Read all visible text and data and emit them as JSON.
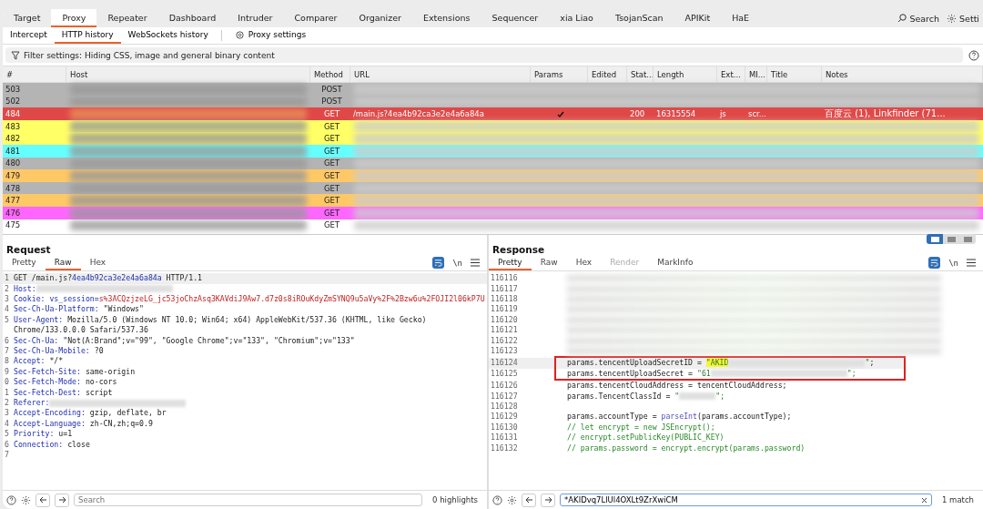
{
  "tabs": [
    {
      "label": "Target",
      "selected": false
    },
    {
      "label": "Proxy",
      "selected": true
    },
    {
      "label": "Repeater",
      "selected": false
    },
    {
      "label": "Dashboard",
      "selected": false
    },
    {
      "label": "Intruder",
      "selected": false
    },
    {
      "label": "Comparer",
      "selected": false
    },
    {
      "label": "Organizer",
      "selected": false
    },
    {
      "label": "Extensions",
      "selected": false
    },
    {
      "label": "Sequencer",
      "selected": false
    },
    {
      "label": "xia Liao",
      "selected": false
    },
    {
      "label": "TsojanScan",
      "selected": false
    },
    {
      "label": "APIKit",
      "selected": false
    },
    {
      "label": "HaE",
      "selected": false
    }
  ],
  "top_actions": {
    "search": "Search",
    "settings": "Setti"
  },
  "sub_tabs": [
    {
      "label": "Intercept",
      "selected": false
    },
    {
      "label": "HTTP history",
      "selected": true
    },
    {
      "label": "WebSockets history",
      "selected": false
    }
  ],
  "proxy_settings": "Proxy settings",
  "filter": "Filter settings: Hiding CSS, image and general binary content",
  "table": {
    "columns": [
      "#",
      "Host",
      "Method",
      "URL",
      "Params",
      "Edited",
      "Stat...",
      "Length",
      "Ext...",
      "MI...",
      "Title",
      "Notes"
    ],
    "rows": [
      {
        "number": "503",
        "method": "POST",
        "color": "#b4b4b4",
        "selected": false
      },
      {
        "number": "502",
        "method": "POST",
        "color": "#b4b4b4",
        "selected": false
      },
      {
        "number": "484",
        "method": "GET",
        "color": "#e04848",
        "selected": true,
        "url": "/main.js?4ea4b92ca3e2e4a6a84a",
        "params": true,
        "status": "200",
        "length": "16315554",
        "ext": "js",
        "mime": "scr...",
        "notes": "百度云 (1), Linkfinder (71..."
      },
      {
        "number": "483",
        "method": "GET",
        "color": "#ffff66",
        "selected": false
      },
      {
        "number": "482",
        "method": "GET",
        "color": "#ffff66",
        "selected": false
      },
      {
        "number": "481",
        "method": "GET",
        "color": "#66ffff",
        "selected": false
      },
      {
        "number": "480",
        "method": "GET",
        "color": "#b4b4b4",
        "selected": false
      },
      {
        "number": "479",
        "method": "GET",
        "color": "#ffc866",
        "selected": false
      },
      {
        "number": "478",
        "method": "GET",
        "color": "#b4b4b4",
        "selected": false
      },
      {
        "number": "477",
        "method": "GET",
        "color": "#ffc866",
        "selected": false
      },
      {
        "number": "476",
        "method": "GET",
        "color": "#ff66ff",
        "selected": false
      },
      {
        "number": "475",
        "method": "GET",
        "color": "#ffffff",
        "selected": false
      }
    ]
  },
  "request": {
    "title": "Request",
    "tabs": [
      {
        "label": "Pretty",
        "selected": false
      },
      {
        "label": "Raw",
        "selected": true
      },
      {
        "label": "Hex",
        "selected": false
      }
    ],
    "wrap_icon": "\\n",
    "lines": [
      {
        "num": "1",
        "segments": [
          {
            "text": "GET /main.js?",
            "kind": "plain"
          },
          {
            "text": "4ea4b92ca3e2e4a6a84a",
            "kind": "name"
          },
          {
            "text": " HTTP/1.1",
            "kind": "plain"
          }
        ],
        "current": true
      },
      {
        "num": "2",
        "segments": [
          {
            "text": "Host:",
            "kind": "name"
          },
          {
            "kind": "redacted"
          }
        ],
        "current": false
      },
      {
        "num": "3",
        "segments": [
          {
            "text": "Cookie:",
            "kind": "name"
          },
          {
            "text": " vs_session=",
            "kind": "name"
          },
          {
            "text": "s%3ACQzjzeLG_jc53joChzAsq3KAVdiJ9Aw7.d7z0s8iROuKdyZmSYNQ9u5aVy%2F%2Bzw6u%2FOJI2l06kP7U",
            "kind": "cookie"
          }
        ],
        "current": false
      },
      {
        "num": "4",
        "segments": [
          {
            "text": "Sec-Ch-Ua-Platform:",
            "kind": "name"
          },
          {
            "text": " \"Windows\"",
            "kind": "plain"
          }
        ],
        "current": false
      },
      {
        "num": "5",
        "segments": [
          {
            "text": "User-Agent:",
            "kind": "name"
          },
          {
            "text": " Mozilla/5.0 (Windows NT 10.0; Win64; x64) AppleWebKit/537.36 (KHTML, like Gecko) Chrome/133.0.0.0 Safari/537.36",
            "kind": "plain"
          }
        ],
        "current": false
      },
      {
        "num": "6",
        "segments": [
          {
            "text": "Sec-Ch-Ua:",
            "kind": "name"
          },
          {
            "text": " \"Not(A:Brand\";v=\"99\", \"Google Chrome\";v=\"133\", \"Chromium\";v=\"133\"",
            "kind": "plain"
          }
        ],
        "current": false
      },
      {
        "num": "7",
        "segments": [
          {
            "text": "Sec-Ch-Ua-Mobile:",
            "kind": "name"
          },
          {
            "text": " ?0",
            "kind": "plain"
          }
        ],
        "current": false
      },
      {
        "num": "8",
        "segments": [
          {
            "text": "Accept:",
            "kind": "name"
          },
          {
            "text": " */*",
            "kind": "plain"
          }
        ],
        "current": false
      },
      {
        "num": "9",
        "segments": [
          {
            "text": "Sec-Fetch-Site:",
            "kind": "name"
          },
          {
            "text": " same-origin",
            "kind": "plain"
          }
        ],
        "current": false
      },
      {
        "num": "0",
        "segments": [
          {
            "text": "Sec-Fetch-Mode:",
            "kind": "name"
          },
          {
            "text": " no-cors",
            "kind": "plain"
          }
        ],
        "current": false
      },
      {
        "num": "1",
        "segments": [
          {
            "text": "Sec-Fetch-Dest:",
            "kind": "name"
          },
          {
            "text": " script",
            "kind": "plain"
          }
        ],
        "current": false
      },
      {
        "num": "2",
        "segments": [
          {
            "text": "Referer:",
            "kind": "name"
          },
          {
            "kind": "redacted"
          }
        ],
        "current": false
      },
      {
        "num": "3",
        "segments": [
          {
            "text": "Accept-Encoding:",
            "kind": "name"
          },
          {
            "text": " gzip, deflate, br",
            "kind": "plain"
          }
        ],
        "current": false
      },
      {
        "num": "4",
        "segments": [
          {
            "text": "Accept-Language:",
            "kind": "name"
          },
          {
            "text": " zh-CN,zh;q=0.9",
            "kind": "plain"
          }
        ],
        "current": false
      },
      {
        "num": "5",
        "segments": [
          {
            "text": "Priority:",
            "kind": "name"
          },
          {
            "text": " u=1",
            "kind": "plain"
          }
        ],
        "current": false
      },
      {
        "num": "6",
        "segments": [
          {
            "text": "Connection:",
            "kind": "name"
          },
          {
            "text": " close",
            "kind": "plain"
          }
        ],
        "current": false
      },
      {
        "num": "7",
        "current": false
      }
    ],
    "search": {
      "placeholder": "Search"
    },
    "result": "0 highlights"
  },
  "response": {
    "title": "Response",
    "tabs": [
      {
        "label": "Pretty",
        "selected": true,
        "disabled": false
      },
      {
        "label": "Raw",
        "selected": false,
        "disabled": false
      },
      {
        "label": "Hex",
        "selected": false,
        "disabled": false
      },
      {
        "label": "Render",
        "selected": false,
        "disabled": true
      },
      {
        "label": "MarkInfo",
        "selected": false,
        "disabled": false
      }
    ],
    "wrap_icon": "\\n",
    "layout_options": [
      {
        "selected": true
      },
      {
        "selected": false
      },
      {
        "selected": false
      }
    ],
    "lines": [
      {
        "num": "116116",
        "blurred": true,
        "current": false,
        "boxed": false
      },
      {
        "num": "116117",
        "blurred": true,
        "current": false,
        "boxed": false
      },
      {
        "num": "116118",
        "blurred": true,
        "current": false,
        "boxed": false
      },
      {
        "num": "116119",
        "blurred": true,
        "current": false,
        "boxed": false
      },
      {
        "num": "116120",
        "blurred": true,
        "current": false,
        "boxed": false
      },
      {
        "num": "116121",
        "blurred": true,
        "current": false,
        "boxed": false
      },
      {
        "num": "116122",
        "blurred": true,
        "current": false,
        "boxed": false
      },
      {
        "num": "116123",
        "blurred": true,
        "current": false,
        "boxed": false
      },
      {
        "num": "116124",
        "segments": [
          {
            "text": "params.tencentUploadSecretID = ",
            "kind": "plain"
          },
          {
            "text": "\"AKID",
            "kind": "match"
          },
          {
            "kind": "redacted"
          },
          {
            "text": "\"",
            "kind": "string"
          },
          {
            "text": ";",
            "kind": "plain"
          }
        ],
        "current": true,
        "boxed": true
      },
      {
        "num": "116125",
        "segments": [
          {
            "text": "params.tencentUploadSecret = ",
            "kind": "plain"
          },
          {
            "text": "\"61",
            "kind": "string"
          },
          {
            "kind": "redacted"
          },
          {
            "text": "\";",
            "kind": "string"
          }
        ],
        "current": false,
        "boxed": true
      },
      {
        "num": "116126",
        "segments": [
          {
            "text": "params.tencentCloudAddress = tencentCloudAddress;",
            "kind": "plain"
          }
        ],
        "current": false,
        "boxed": false
      },
      {
        "num": "116127",
        "segments": [
          {
            "text": "params.TencentClassId = ",
            "kind": "plain"
          },
          {
            "text": "\"",
            "kind": "string"
          },
          {
            "kind": "redacted-short"
          },
          {
            "text": "\";",
            "kind": "string"
          }
        ],
        "current": false,
        "boxed": false
      },
      {
        "num": "116128",
        "current": false,
        "boxed": false
      },
      {
        "num": "116129",
        "segments": [
          {
            "text": "params.accountType = ",
            "kind": "plain"
          },
          {
            "text": "parseInt",
            "kind": "func"
          },
          {
            "text": "(params.accountType);",
            "kind": "plain"
          }
        ],
        "current": false,
        "boxed": false
      },
      {
        "num": "116130",
        "segments": [
          {
            "text": "// let encrypt = new JSEncrypt();",
            "kind": "comment"
          }
        ],
        "current": false,
        "boxed": false
      },
      {
        "num": "116131",
        "segments": [
          {
            "text": "// encrypt.setPublicKey(PUBLIC_KEY)",
            "kind": "comment"
          }
        ],
        "current": false,
        "boxed": false
      },
      {
        "num": "116132",
        "segments": [
          {
            "text": "// params.password = encrypt.encrypt(params.password)",
            "kind": "comment"
          }
        ],
        "current": false,
        "boxed": false
      }
    ],
    "search": {
      "value": "*AKIDvq7LlUl4OXLt9ZrXwiCM"
    },
    "result": "1 match"
  }
}
